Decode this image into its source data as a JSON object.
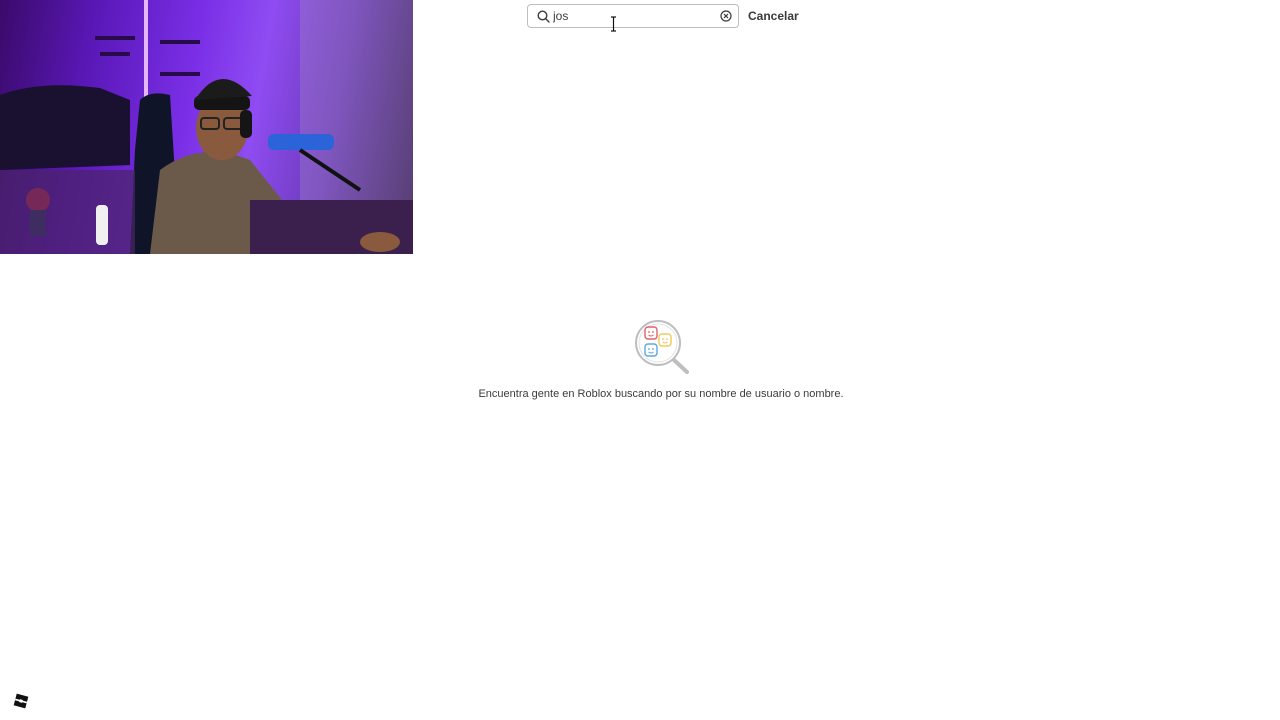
{
  "search": {
    "value": "jos",
    "cancel_label": "Cancelar"
  },
  "empty_state": {
    "message": "Encuentra gente en Roblox buscando por su nombre de usuario o nombre."
  },
  "icons": {
    "search": "search-icon",
    "clear": "clear-circle-x-icon",
    "illustration": "magnifying-glass-faces-icon",
    "logo": "roblox-logo-icon"
  },
  "colors": {
    "text": "#393b3d",
    "border": "#bdbec0",
    "webcam_accent": "#7a2fe6"
  }
}
